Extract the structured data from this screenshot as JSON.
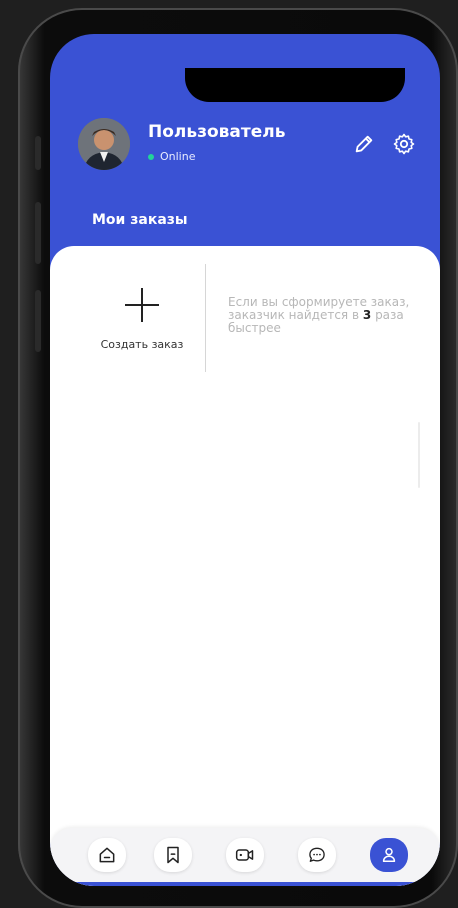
{
  "header": {
    "user_name": "Пользователь",
    "status": "Online",
    "section_title": "Мои заказы"
  },
  "content": {
    "create_order_label": "Создать заказ",
    "hint_part1": "Если вы сформируете заказ, заказчик найдется в",
    "hint_number": "3",
    "hint_part2": "раза быстрее"
  },
  "icons": {
    "edit": "pencil-icon",
    "settings": "gear-icon",
    "nav": [
      "home-icon",
      "bookmark-icon",
      "video-icon",
      "chat-icon",
      "user-icon"
    ]
  },
  "colors": {
    "accent": "#3a52d4",
    "online": "#22d39a",
    "card": "#ffffff",
    "frame": "#0a0a0a"
  },
  "bottom_nav": {
    "active_index": 4
  }
}
